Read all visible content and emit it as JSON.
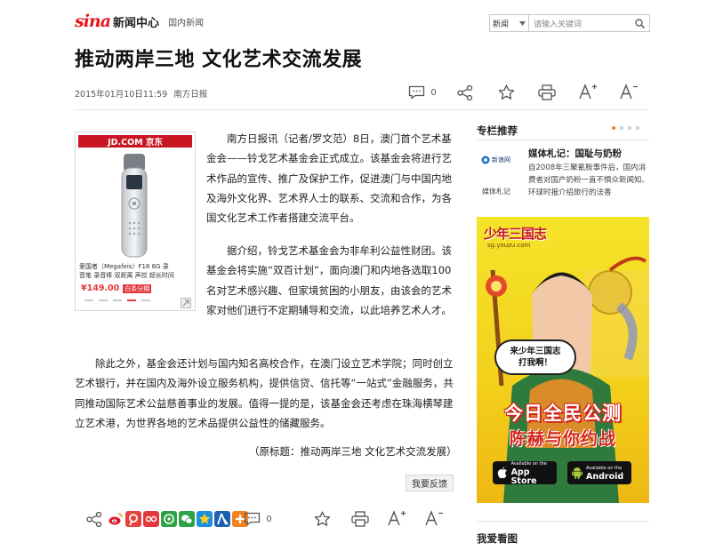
{
  "header": {
    "logo_text": "sina",
    "site_name": "新闻中心",
    "channel": "国内新闻",
    "search": {
      "select_value": "新闻",
      "placeholder": "请输入关键词"
    }
  },
  "article": {
    "title": "推动两岸三地 文化艺术交流发展",
    "datetime": "2015年01月10日11:59",
    "source": "南方日报",
    "comment_count": "0",
    "paragraphs": [
      "南方日报讯（记者/罗文范）8日，澳门首个艺术基金会——铃戈艺术基金会正式成立。该基金会将进行艺术作品的宣传、推广及保护工作，促进澳门与中国内地及海外文化界、艺术界人士的联系、交流和合作，为各国文化艺术工作者搭建交流平台。",
      "据介绍，铃戈艺术基金会为非牟利公益性财团。该基金会将实施“双百计划”，面向澳门和内地各选取100名对艺术感兴趣、但家境贫困的小朋友，由该会的艺术家对他们进行不定期辅导和交流，以此培养艺术人才。",
      "除此之外，基金会还计划与国内知名高校合作，在澳门设立艺术学院；同时创立艺术银行，并在国内及海外设立服务机构，提供信贷、信托等“一站式”金融服务，共同推动国际艺术公益慈善事业的发展。值得一提的是，该基金会还考虑在珠海横琴建立艺术港，为世界各地的艺术品提供公益性的储藏服务。"
    ],
    "original_title": "（原标题：推动两岸三地 文化艺术交流发展）",
    "feedback_label": "我要反馈"
  },
  "ad": {
    "brand": "JD.COM 京东",
    "product_line1": "爱国者（Megafeis）F18 8G 录",
    "product_line2": "音笔 录音棒 双距离 声控 超长时间",
    "price": "¥149.00",
    "tag": "白条分期"
  },
  "sidebar": {
    "recommend_title": "专栏推荐",
    "featured": {
      "name": "媒体札记：国耻与奶粉",
      "desc": "自2008年三聚氰胺事件后，国内消费者对国产奶粉一直不惧众新闻知、环球时报介绍旅行的法香",
      "logo_label": "媒体札记",
      "logo_brand": "新浪网"
    },
    "banner": {
      "logo": "少年三国志",
      "url": "sg.youzu.com",
      "bubble_line1": "来少年三国志",
      "bubble_line2": "打我啊！",
      "slogan1": "今日全民公测",
      "slogan2": "陈赫与你约战",
      "appstore_small": "Available on the",
      "appstore": "App Store",
      "android_small": "Available on the",
      "android": "Android"
    },
    "favorites_title": "我爱看图"
  },
  "share": {
    "comment_count": "0"
  }
}
